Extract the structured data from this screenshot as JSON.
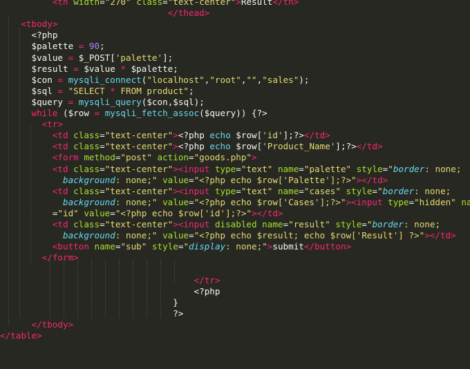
{
  "editor": {
    "lines": [
      [
        {
          "t": "          ",
          "c": "plain"
        },
        {
          "t": "<th ",
          "c": "tag"
        },
        {
          "t": "width",
          "c": "attr"
        },
        {
          "t": "=",
          "c": "plain"
        },
        {
          "t": "\"270\"",
          "c": "str"
        },
        {
          "t": " class",
          "c": "attr"
        },
        {
          "t": "=",
          "c": "plain"
        },
        {
          "t": "\"text-center\"",
          "c": "str"
        },
        {
          "t": ">",
          "c": "tag"
        },
        {
          "t": "Result",
          "c": "plain"
        },
        {
          "t": "</th>",
          "c": "tag"
        }
      ],
      [
        {
          "t": "                                ",
          "c": "plain"
        },
        {
          "t": "</",
          "c": "tag"
        },
        {
          "t": "thead",
          "c": "tag"
        },
        {
          "t": ">",
          "c": "tag"
        }
      ],
      [
        {
          "t": "    ",
          "c": "plain"
        },
        {
          "t": "<tbody>",
          "c": "tag"
        }
      ],
      [
        {
          "t": "      ",
          "c": "plain"
        },
        {
          "t": "<?php",
          "c": "php"
        }
      ],
      [
        {
          "t": "      ",
          "c": "plain"
        },
        {
          "t": "$palette",
          "c": "plain"
        },
        {
          "t": " = ",
          "c": "kw"
        },
        {
          "t": "90",
          "c": "num"
        },
        {
          "t": ";",
          "c": "plain"
        }
      ],
      [
        {
          "t": "      ",
          "c": "plain"
        },
        {
          "t": "$value",
          "c": "plain"
        },
        {
          "t": " = ",
          "c": "kw"
        },
        {
          "t": "$_POST",
          "c": "plain"
        },
        {
          "t": "[",
          "c": "plain"
        },
        {
          "t": "'palette'",
          "c": "str"
        },
        {
          "t": "];",
          "c": "plain"
        }
      ],
      [
        {
          "t": "      ",
          "c": "plain"
        },
        {
          "t": "$result",
          "c": "plain"
        },
        {
          "t": " = ",
          "c": "kw"
        },
        {
          "t": "$value",
          "c": "plain"
        },
        {
          "t": " * ",
          "c": "kw"
        },
        {
          "t": "$palette",
          "c": "plain"
        },
        {
          "t": ";",
          "c": "plain"
        }
      ],
      [
        {
          "t": "      ",
          "c": "plain"
        },
        {
          "t": "$con",
          "c": "plain"
        },
        {
          "t": " = ",
          "c": "kw"
        },
        {
          "t": "mysqli_connect",
          "c": "fn"
        },
        {
          "t": "(",
          "c": "plain"
        },
        {
          "t": "\"localhost\"",
          "c": "str"
        },
        {
          "t": ",",
          "c": "plain"
        },
        {
          "t": "\"root\"",
          "c": "str"
        },
        {
          "t": ",",
          "c": "plain"
        },
        {
          "t": "\"\"",
          "c": "str"
        },
        {
          "t": ",",
          "c": "plain"
        },
        {
          "t": "\"sales\"",
          "c": "str"
        },
        {
          "t": ");",
          "c": "plain"
        }
      ],
      [
        {
          "t": "      ",
          "c": "plain"
        },
        {
          "t": "$sql",
          "c": "plain"
        },
        {
          "t": " = ",
          "c": "kw"
        },
        {
          "t": "\"SELECT ",
          "c": "str"
        },
        {
          "t": "*",
          "c": "kw"
        },
        {
          "t": " FROM product\"",
          "c": "str"
        },
        {
          "t": ";",
          "c": "plain"
        }
      ],
      [
        {
          "t": "      ",
          "c": "plain"
        },
        {
          "t": "$query",
          "c": "plain"
        },
        {
          "t": " = ",
          "c": "kw"
        },
        {
          "t": "mysqli_query",
          "c": "fn"
        },
        {
          "t": "(",
          "c": "plain"
        },
        {
          "t": "$con",
          "c": "plain"
        },
        {
          "t": ",",
          "c": "plain"
        },
        {
          "t": "$sql",
          "c": "plain"
        },
        {
          "t": ");",
          "c": "plain"
        }
      ],
      [
        {
          "t": "      ",
          "c": "plain"
        },
        {
          "t": "while",
          "c": "kw"
        },
        {
          "t": " (",
          "c": "plain"
        },
        {
          "t": "$row",
          "c": "plain"
        },
        {
          "t": " = ",
          "c": "kw"
        },
        {
          "t": "mysqli_fetch_assoc",
          "c": "fn"
        },
        {
          "t": "(",
          "c": "plain"
        },
        {
          "t": "$query",
          "c": "plain"
        },
        {
          "t": ")) {?>",
          "c": "plain"
        }
      ],
      [
        {
          "t": "        ",
          "c": "plain"
        },
        {
          "t": "<tr>",
          "c": "tag"
        }
      ],
      [
        {
          "t": "          ",
          "c": "plain"
        },
        {
          "t": "<td ",
          "c": "tag"
        },
        {
          "t": "class",
          "c": "attr"
        },
        {
          "t": "=",
          "c": "plain"
        },
        {
          "t": "\"text-center\"",
          "c": "str"
        },
        {
          "t": ">",
          "c": "tag"
        },
        {
          "t": "<?php ",
          "c": "plain"
        },
        {
          "t": "echo ",
          "c": "fn"
        },
        {
          "t": "$row",
          "c": "plain"
        },
        {
          "t": "[",
          "c": "plain"
        },
        {
          "t": "'id'",
          "c": "str"
        },
        {
          "t": "];?>",
          "c": "plain"
        },
        {
          "t": "</td>",
          "c": "tag"
        }
      ],
      [
        {
          "t": "          ",
          "c": "plain"
        },
        {
          "t": "<td ",
          "c": "tag"
        },
        {
          "t": "class",
          "c": "attr"
        },
        {
          "t": "=",
          "c": "plain"
        },
        {
          "t": "\"text-center\"",
          "c": "str"
        },
        {
          "t": ">",
          "c": "tag"
        },
        {
          "t": "<?php ",
          "c": "plain"
        },
        {
          "t": "echo ",
          "c": "fn"
        },
        {
          "t": "$row",
          "c": "plain"
        },
        {
          "t": "[",
          "c": "plain"
        },
        {
          "t": "'Product_Name'",
          "c": "str"
        },
        {
          "t": "];?>",
          "c": "plain"
        },
        {
          "t": "</td>",
          "c": "tag"
        }
      ],
      [
        {
          "t": "          ",
          "c": "plain"
        },
        {
          "t": "<form ",
          "c": "tag"
        },
        {
          "t": "method",
          "c": "attr"
        },
        {
          "t": "=",
          "c": "plain"
        },
        {
          "t": "\"post\"",
          "c": "str"
        },
        {
          "t": " action",
          "c": "attr"
        },
        {
          "t": "=",
          "c": "plain"
        },
        {
          "t": "\"goods.php\"",
          "c": "str"
        },
        {
          "t": ">",
          "c": "tag"
        }
      ],
      [
        {
          "t": "          ",
          "c": "plain"
        },
        {
          "t": "<td ",
          "c": "tag"
        },
        {
          "t": "class",
          "c": "attr"
        },
        {
          "t": "=",
          "c": "plain"
        },
        {
          "t": "\"text-center\"",
          "c": "str"
        },
        {
          "t": ">",
          "c": "tag"
        },
        {
          "t": "<input ",
          "c": "tag"
        },
        {
          "t": "type",
          "c": "attr"
        },
        {
          "t": "=",
          "c": "plain"
        },
        {
          "t": "\"text\"",
          "c": "str"
        },
        {
          "t": " name",
          "c": "attr"
        },
        {
          "t": "=",
          "c": "plain"
        },
        {
          "t": "\"palette\"",
          "c": "str"
        },
        {
          "t": " style",
          "c": "attr"
        },
        {
          "t": "=",
          "c": "plain"
        },
        {
          "t": "\"",
          "c": "str"
        },
        {
          "t": "border",
          "c": "prop"
        },
        {
          "t": ": none;",
          "c": "str"
        }
      ],
      [
        {
          "t": "            ",
          "c": "plain"
        },
        {
          "t": "background",
          "c": "prop"
        },
        {
          "t": ": none;\"",
          "c": "str"
        },
        {
          "t": " value",
          "c": "attr"
        },
        {
          "t": "=",
          "c": "plain"
        },
        {
          "t": "\"<?php echo $row['Palette'];?>\"",
          "c": "str"
        },
        {
          "t": ">",
          "c": "tag"
        },
        {
          "t": "</td>",
          "c": "tag"
        }
      ],
      [
        {
          "t": "          ",
          "c": "plain"
        },
        {
          "t": "<td ",
          "c": "tag"
        },
        {
          "t": "class",
          "c": "attr"
        },
        {
          "t": "=",
          "c": "plain"
        },
        {
          "t": "\"text-center\"",
          "c": "str"
        },
        {
          "t": ">",
          "c": "tag"
        },
        {
          "t": "<input ",
          "c": "tag"
        },
        {
          "t": "type",
          "c": "attr"
        },
        {
          "t": "=",
          "c": "plain"
        },
        {
          "t": "\"text\"",
          "c": "str"
        },
        {
          "t": " name",
          "c": "attr"
        },
        {
          "t": "=",
          "c": "plain"
        },
        {
          "t": "\"cases\"",
          "c": "str"
        },
        {
          "t": " style",
          "c": "attr"
        },
        {
          "t": "=",
          "c": "plain"
        },
        {
          "t": "\"",
          "c": "str"
        },
        {
          "t": "border",
          "c": "prop"
        },
        {
          "t": ": none;",
          "c": "str"
        }
      ],
      [
        {
          "t": "            ",
          "c": "plain"
        },
        {
          "t": "background",
          "c": "prop"
        },
        {
          "t": ": none;\"",
          "c": "str"
        },
        {
          "t": " value",
          "c": "attr"
        },
        {
          "t": "=",
          "c": "plain"
        },
        {
          "t": "\"<?php echo $row['Cases'];?>\"",
          "c": "str"
        },
        {
          "t": ">",
          "c": "tag"
        },
        {
          "t": "<input ",
          "c": "tag"
        },
        {
          "t": "type",
          "c": "attr"
        },
        {
          "t": "=",
          "c": "plain"
        },
        {
          "t": "\"hidden\"",
          "c": "str"
        },
        {
          "t": " name",
          "c": "attr"
        }
      ],
      [
        {
          "t": "          =",
          "c": "plain"
        },
        {
          "t": "\"id\"",
          "c": "str"
        },
        {
          "t": " value",
          "c": "attr"
        },
        {
          "t": "=",
          "c": "plain"
        },
        {
          "t": "\"<?php echo $row['id'];?>\"",
          "c": "str"
        },
        {
          "t": ">",
          "c": "tag"
        },
        {
          "t": "</td>",
          "c": "tag"
        }
      ],
      [
        {
          "t": "          ",
          "c": "plain"
        },
        {
          "t": "<td ",
          "c": "tag"
        },
        {
          "t": "class",
          "c": "attr"
        },
        {
          "t": "=",
          "c": "plain"
        },
        {
          "t": "\"text-center\"",
          "c": "str"
        },
        {
          "t": ">",
          "c": "tag"
        },
        {
          "t": "<input ",
          "c": "tag"
        },
        {
          "t": "disabled name",
          "c": "attr"
        },
        {
          "t": "=",
          "c": "plain"
        },
        {
          "t": "\"result\"",
          "c": "str"
        },
        {
          "t": " style",
          "c": "attr"
        },
        {
          "t": "=",
          "c": "plain"
        },
        {
          "t": "\"",
          "c": "str"
        },
        {
          "t": "border",
          "c": "prop"
        },
        {
          "t": ": none;",
          "c": "str"
        }
      ],
      [
        {
          "t": "            ",
          "c": "plain"
        },
        {
          "t": "background",
          "c": "prop"
        },
        {
          "t": ": none;\"",
          "c": "str"
        },
        {
          "t": " value",
          "c": "attr"
        },
        {
          "t": "=",
          "c": "plain"
        },
        {
          "t": "\"<?php echo $result; echo $row['Result'] ?>\"",
          "c": "str"
        },
        {
          "t": ">",
          "c": "tag"
        },
        {
          "t": "</td>",
          "c": "tag"
        }
      ],
      [
        {
          "t": "          ",
          "c": "plain"
        },
        {
          "t": "<button ",
          "c": "tag"
        },
        {
          "t": "name",
          "c": "attr"
        },
        {
          "t": "=",
          "c": "plain"
        },
        {
          "t": "\"sub\"",
          "c": "str"
        },
        {
          "t": " style",
          "c": "attr"
        },
        {
          "t": "=",
          "c": "plain"
        },
        {
          "t": "\"",
          "c": "str"
        },
        {
          "t": "display",
          "c": "prop"
        },
        {
          "t": ": none;\"",
          "c": "str"
        },
        {
          "t": ">",
          "c": "tag"
        },
        {
          "t": "submit",
          "c": "plain"
        },
        {
          "t": "</button>",
          "c": "tag"
        }
      ],
      [
        {
          "t": "        ",
          "c": "plain"
        },
        {
          "t": "</form>",
          "c": "tag"
        }
      ],
      [
        {
          "t": "",
          "c": "plain"
        }
      ],
      [
        {
          "t": "                                     ",
          "c": "plain"
        },
        {
          "t": "</tr>",
          "c": "tag"
        }
      ],
      [
        {
          "t": "                                     ",
          "c": "plain"
        },
        {
          "t": "<?php",
          "c": "php"
        }
      ],
      [
        {
          "t": "                                 ",
          "c": "plain"
        },
        {
          "t": "}",
          "c": "plain"
        }
      ],
      [
        {
          "t": "                                 ",
          "c": "plain"
        },
        {
          "t": "?>",
          "c": "plain"
        }
      ],
      [
        {
          "t": "      ",
          "c": "plain"
        },
        {
          "t": "</tbody>",
          "c": "tag"
        }
      ],
      [
        {
          "t": "",
          "c": "plain"
        },
        {
          "t": "</table>",
          "c": "tag"
        }
      ]
    ]
  }
}
